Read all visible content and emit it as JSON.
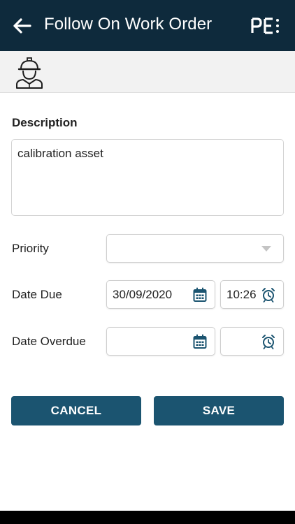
{
  "header": {
    "title": "Follow On Work Order",
    "back_icon": "arrow-left-icon",
    "brand_icon": "pe-logo-icon"
  },
  "subheader": {
    "avatar_icon": "worker-hardhat-icon"
  },
  "form": {
    "description": {
      "label": "Description",
      "value": "calibration asset"
    },
    "priority": {
      "label": "Priority",
      "value": "",
      "icon": "dropdown-caret-icon"
    },
    "date_due": {
      "label": "Date Due",
      "date": "30/09/2020",
      "time": "10:26",
      "date_icon": "calendar-icon",
      "time_icon": "alarm-clock-icon"
    },
    "date_overdue": {
      "label": "Date Overdue",
      "date": "",
      "time": "",
      "date_icon": "calendar-icon",
      "time_icon": "alarm-clock-icon"
    }
  },
  "actions": {
    "cancel_label": "CANCEL",
    "save_label": "SAVE"
  },
  "colors": {
    "appbar": "#0e2a3c",
    "button": "#1b5470",
    "icon_accent": "#1b5470"
  }
}
